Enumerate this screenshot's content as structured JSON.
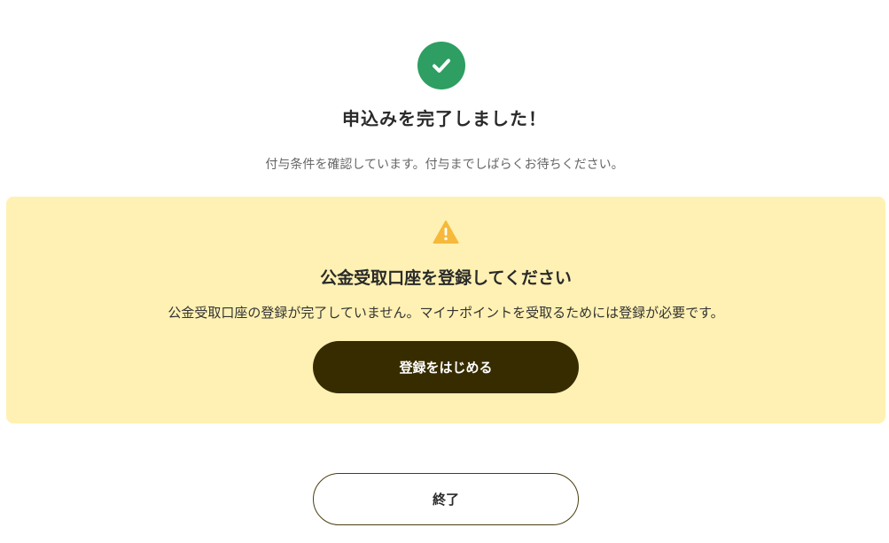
{
  "header": {
    "icon": "check-circle-icon",
    "title": "申込みを完了しました！",
    "subtitle": "付与条件を確認しています。付与までしばらくお待ちください。"
  },
  "notice": {
    "icon": "warning-icon",
    "title": "公金受取口座を登録してください",
    "text": "公金受取口座の登録が完了していません。マイナポイントを受取るためには登録が必要です。",
    "button_label": "登録をはじめる"
  },
  "footer": {
    "close_label": "終了"
  },
  "colors": {
    "success": "#2e9e62",
    "notice_bg": "#fff1b3",
    "warning": "#f6b93b",
    "primary_button": "#372c00"
  }
}
